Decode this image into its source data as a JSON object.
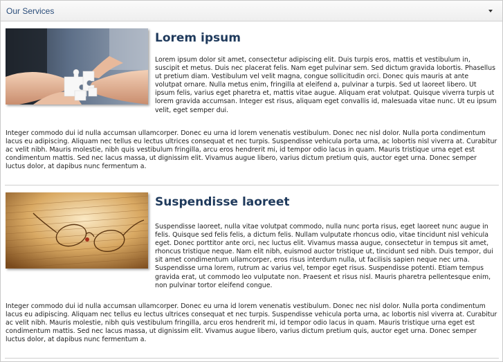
{
  "panel": {
    "title": "Our Services",
    "toggle_icon": "chevron-down-icon"
  },
  "articles": [
    {
      "heading": "Lorem ipsum",
      "image_icon": "puzzle-hands-photo",
      "side_text": "Lorem ipsum dolor sit amet, consectetur adipiscing elit. Duis turpis eros, mattis et vestibulum in, suscipit et metus. Duis nec placerat felis. Nam eget pulvinar sem. Sed dictum gravida lobortis. Phasellus ut pretium diam. Vestibulum vel velit magna, congue sollicitudin orci. Donec quis mauris at ante volutpat ornare. Nulla metus enim, fringilla at eleifend a, pulvinar a turpis. Sed ut laoreet libero. Ut ipsum felis, varius eget pharetra et, mattis vitae augue. Aliquam erat volutpat. Quisque viverra turpis ut lorem gravida accumsan. Integer est risus, aliquam eget convallis id, malesuada vitae nunc. Ut eu ipsum velit, eget semper dui.",
      "full_text": "Integer commodo dui id nulla accumsan ullamcorper. Donec eu urna id lorem venenatis vestibulum. Donec nec nisl dolor. Nulla porta condimentum lacus eu adipiscing. Aliquam nec tellus eu lectus ultrices consequat et nec turpis. Suspendisse vehicula porta urna, ac lobortis nisl viverra at. Curabitur ac velit nibh. Mauris molestie, nibh quis vestibulum fringilla, arcu eros hendrerit mi, id tempor odio lacus in quam. Mauris tristique urna eget est condimentum mattis. Sed nec lacus massa, ut dignissim elit. Vivamus augue libero, varius dictum pretium quis, auctor eget urna. Donec semper luctus dolor, at dapibus nunc fermentum a."
    },
    {
      "heading": "Suspendisse laoreet",
      "image_icon": "glasses-on-newspaper-photo",
      "side_text": "Suspendisse laoreet, nulla vitae volutpat commodo, nulla nunc porta risus, eget laoreet nunc augue in felis. Quisque sed felis felis, a dictum felis. Nullam vulputate rhoncus odio, vitae tincidunt nisl vehicula eget. Donec porttitor ante orci, nec luctus elit. Vivamus massa augue, consectetur in tempus sit amet, rhoncus tristique neque. Nam elit nibh, euismod auctor tristique ut, tincidunt sed nibh. Duis tempor, dui sit amet condimentum ullamcorper, eros risus interdum nulla, ut facilisis sapien neque nec urna. Suspendisse urna lorem, rutrum ac varius vel, tempor eget risus. Suspendisse potenti. Etiam tempus gravida erat, ut commodo leo vulputate non. Praesent et risus nisl. Mauris pharetra pellentesque enim, non pulvinar tortor eleifend congue.",
      "full_text": "Integer commodo dui id nulla accumsan ullamcorper. Donec eu urna id lorem venenatis vestibulum. Donec nec nisl dolor. Nulla porta condimentum lacus eu adipiscing. Aliquam nec tellus eu lectus ultrices consequat et nec turpis. Suspendisse vehicula porta urna, ac lobortis nisl viverra at. Curabitur ac velit nibh. Mauris molestie, nibh quis vestibulum fringilla, arcu eros hendrerit mi, id tempor odio lacus in quam. Mauris tristique urna eget est condimentum mattis. Sed nec lacus massa, ut dignissim elit. Vivamus augue libero, varius dictum pretium quis, auctor eget urna. Donec semper luctus dolor, at dapibus nunc fermentum a."
    }
  ],
  "colors": {
    "heading": "#1f3a5c",
    "panel_title": "#2a4d7a",
    "divider": "#cfcfcf"
  }
}
